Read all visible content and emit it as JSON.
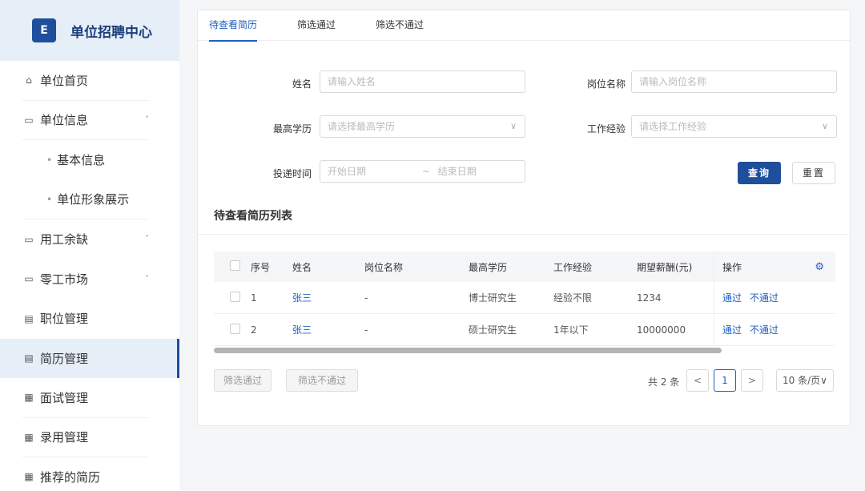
{
  "sidebar": {
    "brand_logo": "E",
    "brand_title": "单位招聘中心",
    "items": [
      {
        "label": "单位首页",
        "icon": "home-icon",
        "glyph": "⌂"
      },
      {
        "label": "单位信息",
        "icon": "folder-icon",
        "glyph": "▭",
        "caret": "˄"
      },
      {
        "label": "基本信息",
        "dot": "•"
      },
      {
        "label": "单位形象展示",
        "dot": "•"
      },
      {
        "label": "用工余缺",
        "icon": "folder-icon",
        "glyph": "▭",
        "caret": "˅"
      },
      {
        "label": "零工市场",
        "icon": "folder-icon",
        "glyph": "▭",
        "caret": "˅"
      },
      {
        "label": "职位管理",
        "icon": "document-icon",
        "glyph": "▤"
      },
      {
        "label": "简历管理",
        "icon": "document-icon",
        "glyph": "▤"
      },
      {
        "label": "面试管理",
        "icon": "list-icon",
        "glyph": "▦"
      },
      {
        "label": "录用管理",
        "icon": "list-icon",
        "glyph": "▦"
      },
      {
        "label": "推荐的简历",
        "icon": "list-icon",
        "glyph": "▦"
      }
    ]
  },
  "tabs": [
    "待查看简历",
    "筛选通过",
    "筛选不通过"
  ],
  "form": {
    "name_label": "姓名",
    "name_placeholder": "请输入姓名",
    "position_label": "岗位名称",
    "position_placeholder": "请输入岗位名称",
    "edu_label": "最高学历",
    "edu_placeholder": "请选择最高学历",
    "exp_label": "工作经验",
    "exp_placeholder": "请选择工作经验",
    "date_label": "投递时间",
    "date_start": "开始日期",
    "date_sep": "~",
    "date_end": "结束日期",
    "query_btn": "查询",
    "reset_btn": "重置",
    "chevron": "∨"
  },
  "list_title": "待查看简历列表",
  "table": {
    "headers": [
      "序号",
      "姓名",
      "岗位名称",
      "最高学历",
      "工作经验",
      "期望薪酬(元)",
      "操作"
    ],
    "settings_glyph": "⚙",
    "rows": [
      {
        "no": "1",
        "name": "张三",
        "position": "-",
        "edu": "博士研究生",
        "exp": "经验不限",
        "salary": "1234",
        "op_pass": "通过",
        "op_fail": "不通过"
      },
      {
        "no": "2",
        "name": "张三",
        "position": "-",
        "edu": "硕士研究生",
        "exp": "1年以下",
        "salary": "10000000",
        "op_pass": "通过",
        "op_fail": "不通过"
      }
    ]
  },
  "bulk": {
    "pass": "筛选通过",
    "fail": "筛选不通过"
  },
  "pager": {
    "total": "共 2 条",
    "prev": "<",
    "current": "1",
    "next": ">",
    "size": "10 条/页∨"
  }
}
